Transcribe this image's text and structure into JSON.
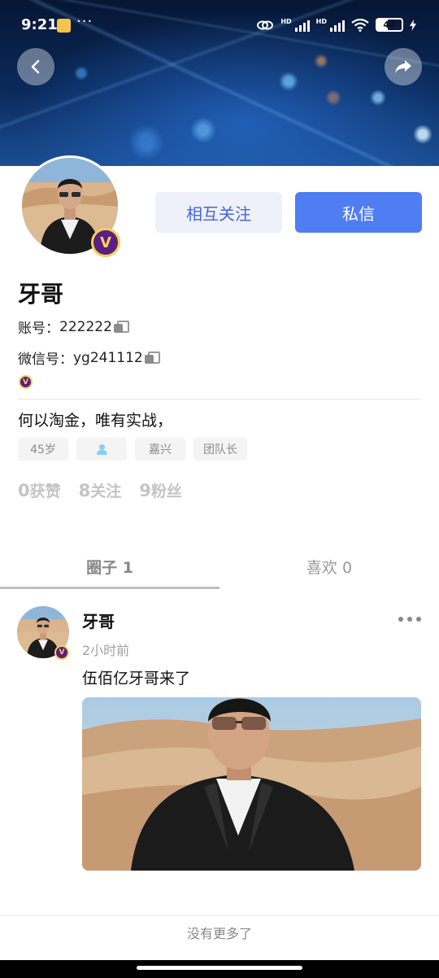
{
  "status_bar": {
    "time": "9:21",
    "more": "···",
    "network_label_1": "HD",
    "network_label_2": "HD",
    "battery": "44"
  },
  "header": {
    "back_icon": "arrow-left-icon",
    "share_icon": "share-arrow-icon"
  },
  "profile": {
    "badge": "V",
    "name": "牙哥",
    "account_label": "账号：",
    "account_value": "222222",
    "wechat_label": "微信号：",
    "wechat_value": "yg241112",
    "bio": "何以淘金，唯有实战，",
    "tags": [
      "45岁",
      "嘉兴",
      "团队长"
    ],
    "stats": {
      "likes_count": "0",
      "likes_label": "获赞",
      "following_count": "8",
      "following_label": "关注",
      "fans_count": "9",
      "fans_label": "粉丝"
    }
  },
  "actions": {
    "follow_label": "相互关注",
    "message_label": "私信"
  },
  "tabs": [
    {
      "label": "圈子 1",
      "active": true
    },
    {
      "label": "喜欢 0",
      "active": false
    }
  ],
  "post": {
    "author": "牙哥",
    "time": "2小时前",
    "text": "伍佰亿牙哥来了"
  },
  "footer": {
    "no_more": "没有更多了"
  },
  "colors": {
    "primary": "#4f7df2",
    "follow_bg": "#eef0fa",
    "follow_text": "#4467d8",
    "badge_purple": "#5b1e82",
    "badge_gold": "#f5cf58"
  }
}
